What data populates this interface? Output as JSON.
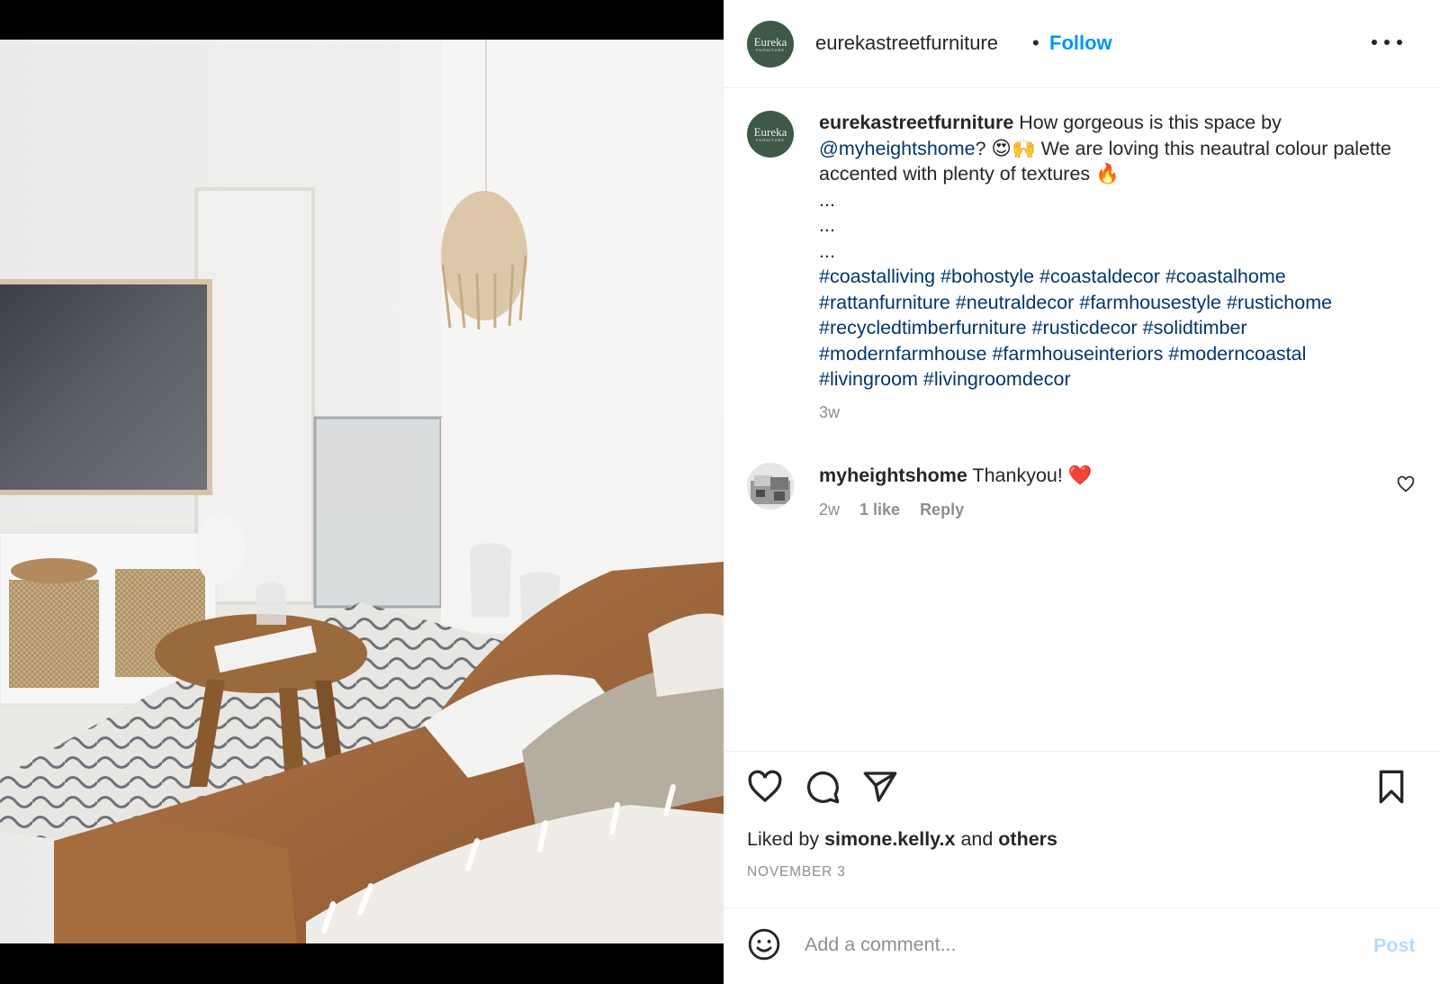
{
  "post": {
    "image_alt": "living room with leather sofa, round wooden coffee table, rattan pendant and TV",
    "author": {
      "username": "eurekastreetfurniture",
      "avatar_text": "Eureka",
      "avatar_subtext": "FURNITURE",
      "follow_label": "Follow",
      "separator": "•"
    },
    "caption": {
      "username": "eurekastreetfurniture",
      "text_1": " How gorgeous is this space by ",
      "mention": "@myheightshome",
      "text_2": "? 😍🙌 We are loving this neautral colour palette accented with plenty of textures 🔥",
      "dots": [
        "...",
        "...",
        "..."
      ],
      "hashtags": "#coastalliving #bohostyle #coastaldecor #coastalhome #rattanfurniture #neutraldecor #farmhousestyle #rustichome #recycledtimberfurniture #rusticdecor #solidtimber #modernfarmhouse #farmhouseinteriors #moderncoastal #livingroom #livingroomdecor",
      "time": "3w"
    },
    "comments": [
      {
        "username": "myheightshome",
        "text": " Thankyou! ❤️",
        "time": "2w",
        "likes": "1 like",
        "reply_label": "Reply"
      }
    ],
    "liked_by": {
      "prefix": "Liked by ",
      "user": "simone.kelly.x",
      "middle": " and ",
      "others": "others"
    },
    "date": "NOVEMBER 3",
    "add_comment": {
      "placeholder": "Add a comment...",
      "post_label": "Post"
    }
  },
  "icons": {
    "more": "more-options-icon",
    "like": "heart-icon",
    "comment": "comment-bubble-icon",
    "share": "paper-plane-icon",
    "save": "bookmark-icon",
    "emoji": "smiley-icon"
  },
  "colors": {
    "follow": "#0095f6",
    "link": "#00376b",
    "muted": "#8e8e8e",
    "post_disabled": "#b3dbff",
    "avatar_bg": "#3e5a46"
  }
}
